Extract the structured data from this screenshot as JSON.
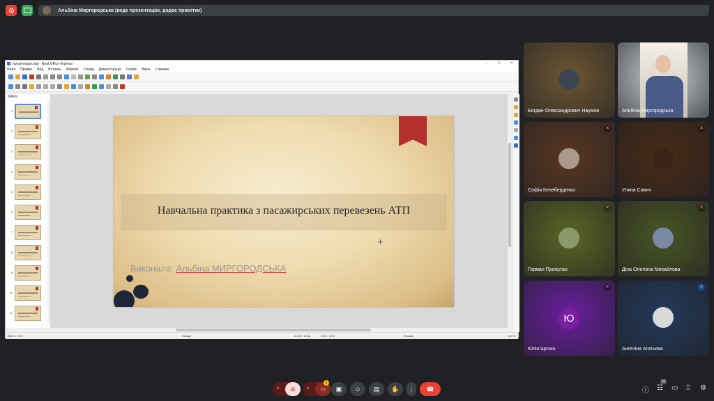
{
  "banner": {
    "text": "Альбіна Миргородська (веде презентацію, додає примітки)"
  },
  "impress": {
    "window_title": "презентація.odp - Neat Office Impress",
    "window_controls": [
      "–",
      "□",
      "×"
    ],
    "menu": [
      "Файл",
      "Правка",
      "Вид",
      "Вставка",
      "Формат",
      "Слайд",
      "Демонстрація",
      "Сервіс",
      "Вікно",
      "Справка"
    ],
    "panel_title": "Slides",
    "slide_numbers": [
      "1",
      "2",
      "3",
      "4",
      "5",
      "6",
      "7",
      "8",
      "9",
      "10",
      "11",
      "12"
    ],
    "slide": {
      "title": "Навчальна практика з пасажирських перевезень АТП",
      "subtitle_prefix": "Виконала: ",
      "subtitle_name": "Альбіна МИРГОРОДСЬКА"
    },
    "status": {
      "slide": "Slide 1 of 17",
      "layout": "Vintage",
      "position": "21,85 / 10,34",
      "size": "0,00 x 0,00",
      "language": "Russian",
      "zoom": "120 %"
    }
  },
  "participants": [
    {
      "name": "Богдан Олександрович Наумов",
      "bg": "#6e5632",
      "muted": false
    },
    {
      "name": "Альбіна Миргородська",
      "bg": "#cfd4d6",
      "muted": false
    },
    {
      "name": "Софія Келеберденко",
      "bg": "#5a3620",
      "muted": true
    },
    {
      "name": "Уляна Савич",
      "bg": "#4a2a16",
      "muted": true
    },
    {
      "name": "Герман Прожуган",
      "bg": "#5a6624",
      "muted": true
    },
    {
      "name": "Діна Олегівна Михайлова",
      "bg": "#4a5624",
      "muted": true
    },
    {
      "name": "Юлія Щочка",
      "bg": "#6a1ea0",
      "muted": true,
      "initial": "Ю"
    },
    {
      "name": "Ангеліна Агатьєва",
      "bg": "#23385a",
      "muted": true
    }
  ],
  "controls": {
    "participants_badge": "10",
    "notification_badge": "1"
  }
}
